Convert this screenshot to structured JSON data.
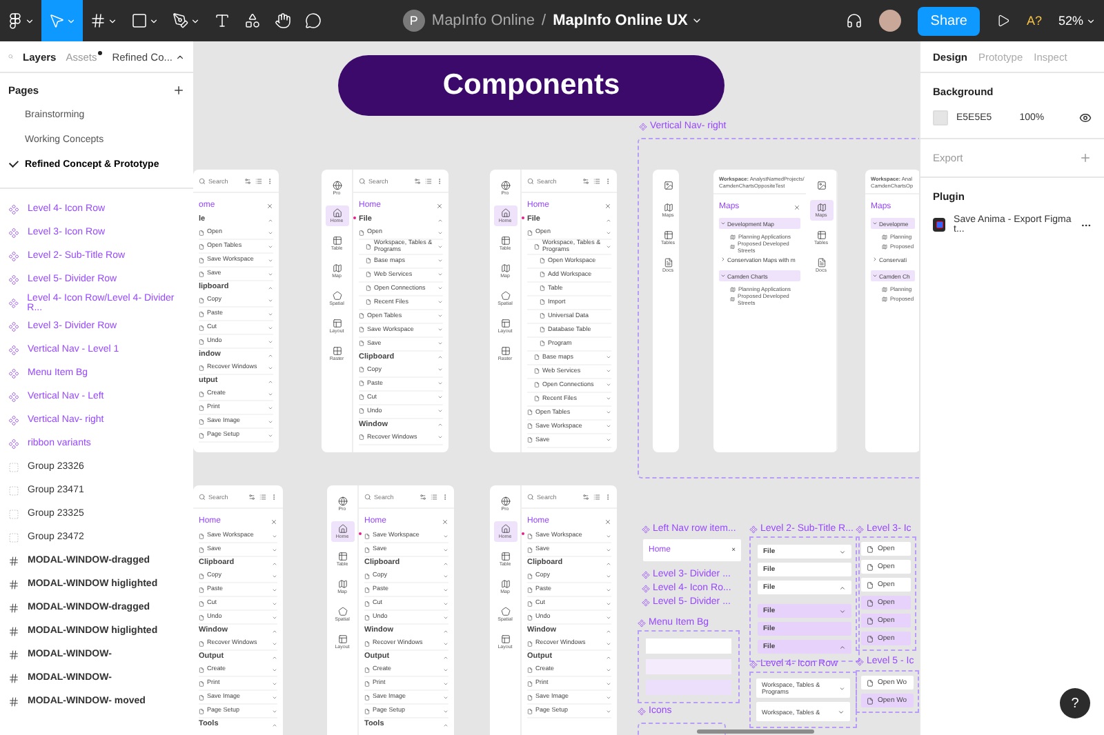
{
  "toolbar": {
    "tools": [
      {
        "kind": "logo",
        "caret": true,
        "selected": false
      },
      {
        "kind": "move",
        "caret": true,
        "selected": true
      },
      {
        "kind": "frame",
        "caret": true,
        "selected": false
      },
      {
        "kind": "shape",
        "caret": true,
        "selected": false
      },
      {
        "kind": "pen",
        "caret": true,
        "selected": false
      },
      {
        "kind": "text",
        "caret": false,
        "selected": false
      },
      {
        "kind": "resources",
        "caret": false,
        "selected": false
      },
      {
        "kind": "hand",
        "caret": false,
        "selected": false
      },
      {
        "kind": "comment",
        "caret": false,
        "selected": false
      }
    ],
    "team_initial": "P",
    "project": "MapInfo Online",
    "separator": "/",
    "file": "MapInfo Online UX",
    "share": "Share",
    "badge": "A?",
    "zoom": "52%"
  },
  "left_panel": {
    "tabs": [
      {
        "label": "Layers",
        "selected": true,
        "dot": false
      },
      {
        "label": "Assets",
        "selected": false,
        "dot": true
      }
    ],
    "page_menu": "Refined Co...",
    "pages_title": "Pages",
    "pages": [
      {
        "label": "Brainstorming",
        "selected": false
      },
      {
        "label": "Working Concepts",
        "selected": false
      },
      {
        "label": "Refined Concept & Prototype",
        "selected": true
      }
    ],
    "layers": [
      {
        "name": "Level 4- Icon Row",
        "kind": "component"
      },
      {
        "name": "Level 3- Icon Row",
        "kind": "component"
      },
      {
        "name": "Level 2- Sub-Title Row",
        "kind": "component"
      },
      {
        "name": "Level 5- Divider Row",
        "kind": "component"
      },
      {
        "name": "Level 4- Icon Row/Level 4- Divider R...",
        "kind": "component"
      },
      {
        "name": "Level 3- Divider Row",
        "kind": "component"
      },
      {
        "name": "Vertical Nav - Level 1",
        "kind": "component"
      },
      {
        "name": "Menu Item Bg",
        "kind": "component"
      },
      {
        "name": "Vertical Nav - Left",
        "kind": "component"
      },
      {
        "name": "Vertical Nav- right",
        "kind": "component"
      },
      {
        "name": "ribbon variants",
        "kind": "component"
      },
      {
        "name": "Group 23326",
        "kind": "group"
      },
      {
        "name": "Group 23471",
        "kind": "group"
      },
      {
        "name": "Group 23325",
        "kind": "group"
      },
      {
        "name": "Group 23472",
        "kind": "group"
      },
      {
        "name": "MODAL-WINDOW-dragged",
        "kind": "frame"
      },
      {
        "name": "MODAL-WINDOW higlighted",
        "kind": "frame"
      },
      {
        "name": "MODAL-WINDOW-dragged",
        "kind": "frame"
      },
      {
        "name": "MODAL-WINDOW higlighted",
        "kind": "frame"
      },
      {
        "name": "MODAL-WINDOW-",
        "kind": "frame"
      },
      {
        "name": "MODAL-WINDOW-",
        "kind": "frame"
      },
      {
        "name": "MODAL-WINDOW- moved",
        "kind": "frame"
      }
    ]
  },
  "canvas": {
    "title": "Components",
    "mock_panels": [
      {
        "search": "Search",
        "title": "ome",
        "rows": [
          {
            "text": "le",
            "kind": "section"
          },
          {
            "text": "Open",
            "kind": "item"
          },
          {
            "text": "Open Tables",
            "kind": "item"
          },
          {
            "text": "Save Workspace",
            "kind": "item"
          },
          {
            "text": "Save",
            "kind": "item"
          },
          {
            "text": "lipboard",
            "kind": "section"
          },
          {
            "text": "Copy",
            "kind": "item"
          },
          {
            "text": "Paste",
            "kind": "item"
          },
          {
            "text": "Cut",
            "kind": "item"
          },
          {
            "text": "Undo",
            "kind": "item"
          },
          {
            "text": "indow",
            "kind": "section"
          },
          {
            "text": "Recover Windows",
            "kind": "item"
          },
          {
            "text": "utput",
            "kind": "section"
          },
          {
            "text": "Create",
            "kind": "item"
          },
          {
            "text": "Print",
            "kind": "item"
          },
          {
            "text": "Save Image",
            "kind": "item"
          },
          {
            "text": "Page Setup",
            "kind": "item"
          }
        ]
      },
      {
        "search": "Search",
        "title": "Home",
        "rail": [
          {
            "kind": "pro",
            "label": "Pro",
            "selected": false
          },
          {
            "kind": "home",
            "label": "Home",
            "selected": true
          },
          {
            "kind": "table",
            "label": "Table",
            "selected": false
          },
          {
            "kind": "map",
            "label": "Map",
            "selected": false
          },
          {
            "kind": "spatial",
            "label": "Spatial",
            "selected": false
          },
          {
            "kind": "layout",
            "label": "Layout",
            "selected": false
          },
          {
            "kind": "raster",
            "label": "Raster",
            "selected": false
          }
        ],
        "rows": [
          {
            "text": "File",
            "kind": "section"
          },
          {
            "text": "Open",
            "kind": "item"
          },
          {
            "text": "Workspace, Tables & Programs",
            "kind": "sub"
          },
          {
            "text": "Base maps",
            "kind": "sub"
          },
          {
            "text": "Web Services",
            "kind": "sub"
          },
          {
            "text": "Open Connections",
            "kind": "sub"
          },
          {
            "text": "Recent Files",
            "kind": "sub"
          },
          {
            "text": "Open Tables",
            "kind": "item"
          },
          {
            "text": "Save Workspace",
            "kind": "item"
          },
          {
            "text": "Save",
            "kind": "item"
          },
          {
            "text": "Clipboard",
            "kind": "section"
          },
          {
            "text": "Copy",
            "kind": "item"
          },
          {
            "text": "Paste",
            "kind": "item"
          },
          {
            "text": "Cut",
            "kind": "item"
          },
          {
            "text": "Undo",
            "kind": "item"
          },
          {
            "text": "Window",
            "kind": "section"
          },
          {
            "text": "Recover Windows",
            "kind": "item"
          }
        ]
      },
      {
        "search": "Search",
        "title": "Home",
        "rail": [
          {
            "kind": "pro",
            "label": "Pro",
            "selected": false
          },
          {
            "kind": "home",
            "label": "Home",
            "selected": true
          },
          {
            "kind": "table",
            "label": "Table",
            "selected": false
          },
          {
            "kind": "map",
            "label": "Map",
            "selected": false
          },
          {
            "kind": "spatial",
            "label": "Spatial",
            "selected": false
          },
          {
            "kind": "layout",
            "label": "Layout",
            "selected": false
          },
          {
            "kind": "raster",
            "label": "Raster",
            "selected": false
          }
        ],
        "rows": [
          {
            "text": "File",
            "kind": "section"
          },
          {
            "text": "Open",
            "kind": "item"
          },
          {
            "text": "Workspace, Tables & Programs",
            "kind": "sub"
          },
          {
            "text": "Open Workspace",
            "kind": "leaf"
          },
          {
            "text": "Add Workspace",
            "kind": "leaf"
          },
          {
            "text": "Table",
            "kind": "leaf"
          },
          {
            "text": "Import",
            "kind": "leaf"
          },
          {
            "text": "Universal Data",
            "kind": "leaf"
          },
          {
            "text": "Database Table",
            "kind": "leaf"
          },
          {
            "text": "Program",
            "kind": "leaf"
          },
          {
            "text": "Base maps",
            "kind": "sub"
          },
          {
            "text": "Web Services",
            "kind": "sub"
          },
          {
            "text": "Open Connections",
            "kind": "sub"
          },
          {
            "text": "Recent Files",
            "kind": "sub"
          },
          {
            "text": "Open Tables",
            "kind": "item"
          },
          {
            "text": "Save Workspace",
            "kind": "item"
          },
          {
            "text": "Save",
            "kind": "item"
          }
        ]
      },
      {
        "search": "Search",
        "title": "Home",
        "rows": [
          {
            "text": "Save Workspace",
            "kind": "item"
          },
          {
            "text": "Save",
            "kind": "item"
          },
          {
            "text": "Clipboard",
            "kind": "section"
          },
          {
            "text": "Copy",
            "kind": "item"
          },
          {
            "text": "Paste",
            "kind": "item"
          },
          {
            "text": "Cut",
            "kind": "item"
          },
          {
            "text": "Undo",
            "kind": "item"
          },
          {
            "text": "Window",
            "kind": "section"
          },
          {
            "text": "Recover Windows",
            "kind": "item"
          },
          {
            "text": "Output",
            "kind": "section"
          },
          {
            "text": "Create",
            "kind": "item"
          },
          {
            "text": "Print",
            "kind": "item"
          },
          {
            "text": "Save Image",
            "kind": "item"
          },
          {
            "text": "Page Setup",
            "kind": "item"
          },
          {
            "text": "Tools",
            "kind": "section"
          }
        ]
      },
      {
        "search": "Search",
        "title": "Home",
        "rail": [
          {
            "kind": "pro",
            "label": "Pro",
            "selected": false
          },
          {
            "kind": "home",
            "label": "Home",
            "selected": true
          },
          {
            "kind": "table",
            "label": "Table",
            "selected": false
          },
          {
            "kind": "map",
            "label": "Map",
            "selected": false
          },
          {
            "kind": "spatial",
            "label": "Spatial",
            "selected": false
          },
          {
            "kind": "layout",
            "label": "Layout",
            "selected": false
          }
        ],
        "rows": [
          {
            "text": "Save Workspace",
            "kind": "item"
          },
          {
            "text": "Save",
            "kind": "item"
          },
          {
            "text": "Clipboard",
            "kind": "section"
          },
          {
            "text": "Copy",
            "kind": "item"
          },
          {
            "text": "Paste",
            "kind": "item"
          },
          {
            "text": "Cut",
            "kind": "item"
          },
          {
            "text": "Undo",
            "kind": "item"
          },
          {
            "text": "Window",
            "kind": "section"
          },
          {
            "text": "Recover Windows",
            "kind": "item"
          },
          {
            "text": "Output",
            "kind": "section"
          },
          {
            "text": "Create",
            "kind": "item"
          },
          {
            "text": "Print",
            "kind": "item"
          },
          {
            "text": "Save Image",
            "kind": "item"
          },
          {
            "text": "Page Setup",
            "kind": "item"
          },
          {
            "text": "Tools",
            "kind": "section"
          }
        ]
      },
      {
        "search": "Search",
        "title": "Home",
        "rail": [
          {
            "kind": "pro",
            "label": "Pro",
            "selected": false
          },
          {
            "kind": "home",
            "label": "Home",
            "selected": true
          },
          {
            "kind": "table",
            "label": "Table",
            "selected": false
          },
          {
            "kind": "map",
            "label": "Map",
            "selected": false
          },
          {
            "kind": "spatial",
            "label": "Spatial",
            "selected": false
          },
          {
            "kind": "layout",
            "label": "Layout",
            "selected": false
          }
        ],
        "rows": [
          {
            "text": "Save Workspace",
            "kind": "item"
          },
          {
            "text": "Save",
            "kind": "item"
          },
          {
            "text": "Clipboard",
            "kind": "section"
          },
          {
            "text": "Copy",
            "kind": "item"
          },
          {
            "text": "Paste",
            "kind": "item"
          },
          {
            "text": "Cut",
            "kind": "item"
          },
          {
            "text": "Undo",
            "kind": "item"
          },
          {
            "text": "Window",
            "kind": "section"
          },
          {
            "text": "Recover Windows",
            "kind": "item"
          },
          {
            "text": "Output",
            "kind": "section"
          },
          {
            "text": "Create",
            "kind": "item"
          },
          {
            "text": "Print",
            "kind": "item"
          },
          {
            "text": "Save Image",
            "kind": "item"
          },
          {
            "text": "Page Setup",
            "kind": "item"
          }
        ]
      }
    ],
    "vertical_nav": {
      "label": "Vertical Nav- right",
      "rail": [
        {
          "kind": "image",
          "selected": false
        },
        {
          "kind": "map",
          "label": "Maps",
          "selected": false
        },
        {
          "kind": "table",
          "label": "Tables",
          "selected": false
        },
        {
          "kind": "docs",
          "label": "Docs",
          "selected": false
        }
      ],
      "panels": [
        {
          "workspace_label": "Workspace:",
          "workspace_path": "AnalystNamedProjects/ CamdenChartsOppositeTest",
          "title": "Maps",
          "rail": [
            {
              "kind": "image",
              "selected": false
            },
            {
              "kind": "map",
              "label": "Maps",
              "selected": true
            },
            {
              "kind": "table",
              "label": "Tables",
              "selected": false
            },
            {
              "kind": "docs",
              "label": "Docs",
              "selected": false
            }
          ],
          "tree": [
            {
              "text": "Development Map",
              "expanded": true,
              "children": [
                {
                  "text": "Planning Applications"
                },
                {
                  "text": "Proposed Developed Streets"
                }
              ]
            },
            {
              "text": "Conservation Maps with m",
              "expanded": false
            },
            {
              "text": "Camden Charts",
              "expanded": true,
              "children": [
                {
                  "text": "Planning Applications"
                },
                {
                  "text": "Proposed Developed Streets"
                }
              ]
            }
          ]
        },
        {
          "workspace_label": "Workspace:",
          "workspace_path": "Anal CamdenChartsOp",
          "title": "Maps",
          "tree": [
            {
              "text": "Developme",
              "expanded": true,
              "children": [
                {
                  "text": "Planning"
                },
                {
                  "text": "Proposed"
                }
              ]
            },
            {
              "text": "Conservati",
              "expanded": false
            },
            {
              "text": "Camden Ch",
              "expanded": true,
              "children": [
                {
                  "text": "Planning"
                },
                {
                  "text": "Proposed"
                }
              ]
            }
          ]
        }
      ]
    },
    "parts": {
      "nav_row_label": "Left Nav row item...",
      "nav_row_title": "Home",
      "nav_row_close": "×",
      "small_labels": [
        "Level 3- Divider ...",
        "Level 4- Icon Ro...",
        "Level 5- Divider ..."
      ],
      "menu_bg_label": "Menu Item Bg",
      "menu_bgs": [
        {
          "kind": "plain"
        },
        {
          "kind": "hover"
        },
        {
          "kind": "selected"
        }
      ],
      "icons_label": "Icons",
      "subtitle_label": "Level 2- Sub-Title R...",
      "subtitle_rows": [
        {
          "text": "File",
          "tint": false,
          "expanded": false
        },
        {
          "text": "File",
          "tint": false
        },
        {
          "text": "File",
          "tint": false,
          "expanded": true
        },
        {
          "text": "File",
          "tint": true,
          "expanded": false
        },
        {
          "text": "File",
          "tint": true
        },
        {
          "text": "File",
          "tint": true,
          "expanded": true
        }
      ],
      "icon_row_label": "Level 4- Icon Row",
      "icon_rows": [
        {
          "text": "Workspace, Tables & Programs"
        },
        {
          "text": "Workspace, Tables &"
        }
      ],
      "level3_label": "Level 3- Ic",
      "level3_rows": [
        {
          "text": "Open",
          "tint": false
        },
        {
          "text": "Open",
          "tint": false
        },
        {
          "text": "Open",
          "tint": false
        },
        {
          "text": "Open",
          "tint": true
        },
        {
          "text": "Open",
          "tint": true
        },
        {
          "text": "Open",
          "tint": true
        }
      ],
      "level5_label": "Level 5 - Ic",
      "level5_rows": [
        {
          "text": "Open Wo",
          "tint": false
        },
        {
          "text": "Open Wo",
          "tint": true
        }
      ]
    }
  },
  "right_panel": {
    "tabs": [
      {
        "label": "Design",
        "selected": true
      },
      {
        "label": "Prototype",
        "selected": false
      },
      {
        "label": "Inspect",
        "selected": false
      }
    ],
    "background_title": "Background",
    "background_hex": "E5E5E5",
    "opacity": "100%",
    "export_title": "Export",
    "plugin_title": "Plugin",
    "plugin_name": "Save Anima - Export Figma t...",
    "help": "?"
  }
}
